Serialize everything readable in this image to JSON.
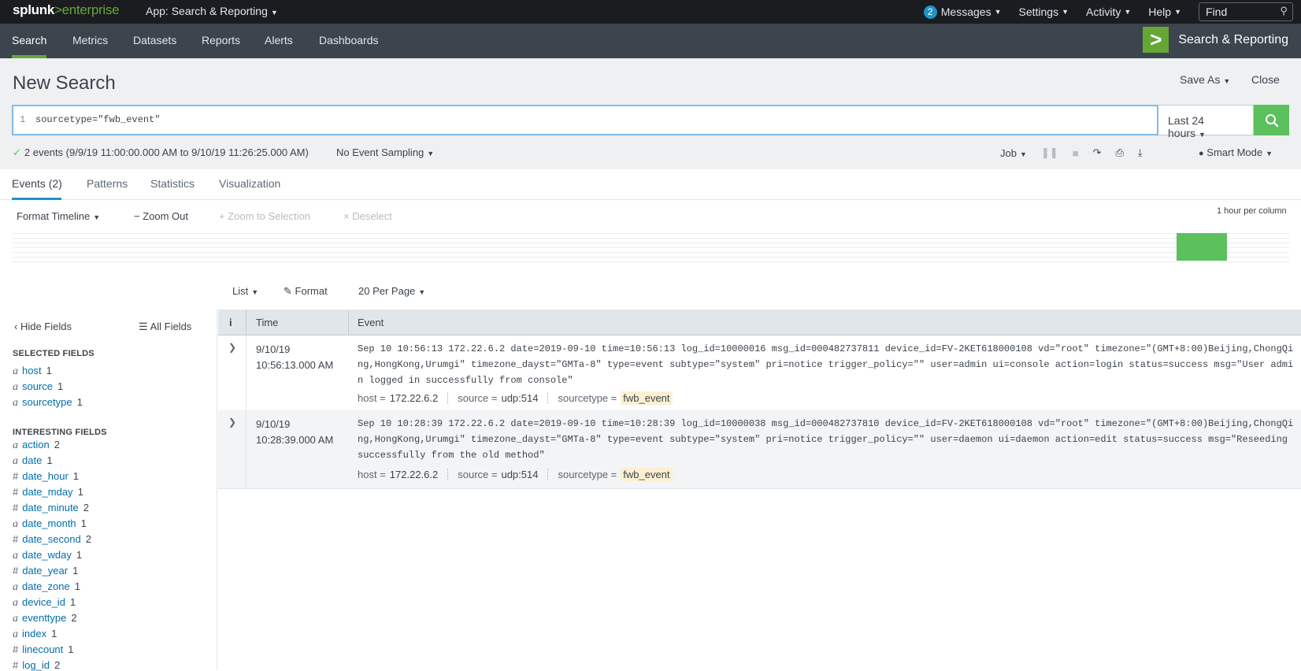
{
  "topbar": {
    "logo_a": "splunk",
    "logo_gt": ">",
    "logo_b": "enterprise",
    "app_menu": "App: Search & Reporting",
    "messages_count": "2",
    "messages": "Messages",
    "settings": "Settings",
    "activity": "Activity",
    "help": "Help",
    "find": "Find"
  },
  "nav": {
    "items": [
      "Search",
      "Metrics",
      "Datasets",
      "Reports",
      "Alerts",
      "Dashboards"
    ],
    "app_title": "Search & Reporting"
  },
  "header": {
    "title": "New Search",
    "save_as": "Save As",
    "close": "Close"
  },
  "search": {
    "line_number": "1",
    "query": "sourcetype=\"fwb_event\"",
    "time_range": "Last 24 hours"
  },
  "status": {
    "summary": "2 events (9/9/19 11:00:00.000 AM to 9/10/19 11:26:25.000 AM)",
    "sampling": "No Event Sampling",
    "job": "Job",
    "mode": "Smart Mode"
  },
  "tabs": [
    "Events (2)",
    "Patterns",
    "Statistics",
    "Visualization"
  ],
  "timeline": {
    "format": "Format Timeline",
    "zoom_out": "Zoom Out",
    "zoom_sel": "Zoom to Selection",
    "deselect": "Deselect",
    "per_column": "1 hour per column"
  },
  "results_toolbar": {
    "list": "List",
    "format": "Format",
    "per_page": "20 Per Page"
  },
  "sidebar": {
    "hide_fields": "Hide Fields",
    "all_fields": "All Fields",
    "selected_head": "SELECTED FIELDS",
    "interesting_head": "INTERESTING FIELDS",
    "selected": [
      {
        "type": "a",
        "name": "host",
        "count": "1"
      },
      {
        "type": "a",
        "name": "source",
        "count": "1"
      },
      {
        "type": "a",
        "name": "sourcetype",
        "count": "1"
      }
    ],
    "interesting": [
      {
        "type": "a",
        "name": "action",
        "count": "2"
      },
      {
        "type": "a",
        "name": "date",
        "count": "1"
      },
      {
        "type": "#",
        "name": "date_hour",
        "count": "1"
      },
      {
        "type": "#",
        "name": "date_mday",
        "count": "1"
      },
      {
        "type": "#",
        "name": "date_minute",
        "count": "2"
      },
      {
        "type": "a",
        "name": "date_month",
        "count": "1"
      },
      {
        "type": "#",
        "name": "date_second",
        "count": "2"
      },
      {
        "type": "a",
        "name": "date_wday",
        "count": "1"
      },
      {
        "type": "#",
        "name": "date_year",
        "count": "1"
      },
      {
        "type": "a",
        "name": "date_zone",
        "count": "1"
      },
      {
        "type": "a",
        "name": "device_id",
        "count": "1"
      },
      {
        "type": "a",
        "name": "eventtype",
        "count": "2"
      },
      {
        "type": "a",
        "name": "index",
        "count": "1"
      },
      {
        "type": "#",
        "name": "linecount",
        "count": "1"
      },
      {
        "type": "#",
        "name": "log_id",
        "count": "2"
      }
    ]
  },
  "table": {
    "col_i": "i",
    "col_time": "Time",
    "col_event": "Event",
    "events": [
      {
        "date": "9/10/19",
        "time": "10:56:13.000 AM",
        "raw": "Sep 10 10:56:13 172.22.6.2 date=2019-09-10 time=10:56:13 log_id=10000016 msg_id=000482737811 device_id=FV-2KET618000108 vd=\"root\" timezone=\"(GMT+8:00)Beijing,ChongQing,HongKong,Urumgi\" timezone_dayst=\"GMTa-8\" type=event subtype=\"system\" pri=notice trigger_policy=\"\" user=admin ui=console action=login status=success msg=\"User admin logged in successfully from console\"",
        "host_k": "host =",
        "host_v": "172.22.6.2",
        "source_k": "source =",
        "source_v": "udp:514",
        "st_k": "sourcetype =",
        "st_v": "fwb_event"
      },
      {
        "date": "9/10/19",
        "time": "10:28:39.000 AM",
        "raw": "Sep 10 10:28:39 172.22.6.2 date=2019-09-10 time=10:28:39 log_id=10000038 msg_id=000482737810 device_id=FV-2KET618000108 vd=\"root\" timezone=\"(GMT+8:00)Beijing,ChongQing,HongKong,Urumgi\" timezone_dayst=\"GMTa-8\" type=event subtype=\"system\" pri=notice trigger_policy=\"\" user=daemon ui=daemon action=edit status=success msg=\"Reseeding successfully from the old method\"",
        "host_k": "host =",
        "host_v": "172.22.6.2",
        "source_k": "source =",
        "source_v": "udp:514",
        "st_k": "sourcetype =",
        "st_v": "fwb_event"
      }
    ]
  },
  "colors": {
    "accent_green": "#5cc05c",
    "brand_green": "#65a637",
    "link_blue": "#006eaa",
    "tab_blue": "#1e93c6"
  }
}
